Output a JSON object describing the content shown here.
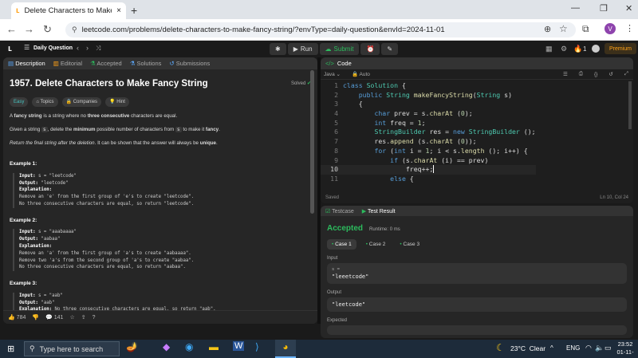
{
  "browser": {
    "tab_title": "Delete Characters to Make Fanc",
    "url": "leetcode.com/problems/delete-characters-to-make-fancy-string/?envType=daily-question&envId=2024-11-01",
    "profile_initial": "V"
  },
  "leetcode_header": {
    "daily_label": "Daily Question",
    "run_label": "Run",
    "submit_label": "Submit",
    "streak_count": "1",
    "premium_label": "Premium"
  },
  "problem": {
    "tabs": [
      "Description",
      "Editorial",
      "Accepted",
      "Solutions",
      "Submissions"
    ],
    "title": "1957. Delete Characters to Make Fancy String",
    "solved_label": "Solved",
    "chips": [
      "Easy",
      "Topics",
      "Companies",
      "Hint"
    ],
    "p1_a": "A ",
    "p1_b": "fancy string",
    "p1_c": " is a string where no ",
    "p1_d": "three",
    "p1_e": " ",
    "p1_f": "consecutive",
    "p1_g": " characters are equal.",
    "p2_a": "Given a string ",
    "p2_s": "s",
    "p2_b": ", delete the ",
    "p2_c": "minimum",
    "p2_d": " possible number of characters from ",
    "p2_e": " to make it ",
    "p2_f": "fancy",
    "p2_g": ".",
    "p3_a": "Return the final string after the deletion",
    "p3_b": ". It can be shown that the answer will always be ",
    "p3_c": "unique",
    "p3_d": ".",
    "examples": [
      {
        "heading": "Example 1:",
        "input_label": "Input:",
        "input": " s = \"leetcode\"",
        "output_label": "Output:",
        "output": " \"leetcode\"",
        "explanation_label": "Explanation:",
        "lines": [
          "Remove an 'e' from the first group of 'e's to create \"leetcode\".",
          "No three consecutive characters are equal, so return \"leetcode\"."
        ]
      },
      {
        "heading": "Example 2:",
        "input_label": "Input:",
        "input": " s = \"aaabaaaa\"",
        "output_label": "Output:",
        "output": " \"aabaa\"",
        "explanation_label": "Explanation:",
        "lines": [
          "Remove an 'a' from the first group of 'a's to create \"aabaaaa\".",
          "Remove two 'a's from the second group of 'a's to create \"aabaa\".",
          "No three consecutive characters are equal, so return \"aabaa\"."
        ]
      },
      {
        "heading": "Example 3:",
        "input_label": "Input:",
        "input": " s = \"aab\"",
        "output_label": "Output:",
        "output": " \"aab\"",
        "explanation_label": "Explanation:",
        "inline_explanation": " No three consecutive characters are equal, so return \"aab\"."
      }
    ],
    "likes": "784",
    "comments": "141"
  },
  "code": {
    "header": "Code",
    "language": "Java",
    "mode": "Auto",
    "saved": "Saved",
    "cursor": "Ln 10, Col 24",
    "lines": [
      "class Solution {",
      "    public String makeFancyString(String s)",
      "    {",
      "        char prev = s.charAt (0);",
      "        int freq = 1;",
      "        StringBuilder res = new StringBuilder ();",
      "        res.append (s.charAt (0));",
      "        for (int i = 1; i < s.length (); i++) {",
      "            if (s.charAt (i) == prev)",
      "                freq++;",
      "            else {"
    ]
  },
  "test": {
    "tabs": [
      "Testcase",
      "Test Result"
    ],
    "status": "Accepted",
    "runtime": "Runtime: 0 ms",
    "cases": [
      "Case 1",
      "Case 2",
      "Case 3"
    ],
    "input_label": "Input",
    "input_var": "s =",
    "input_value": "\"leeetcode\"",
    "output_label": "Output",
    "output_value": "\"leetcode\"",
    "expected_label": "Expected"
  },
  "taskbar": {
    "search_placeholder": "Type here to search",
    "weather": "23°C  Clear",
    "lang": "ENG",
    "time": "23:52",
    "date": "01-11-2024"
  },
  "colors": {
    "accent_green": "#2cbb5d",
    "premium": "#ffa116",
    "easy": "#46c6c2"
  }
}
